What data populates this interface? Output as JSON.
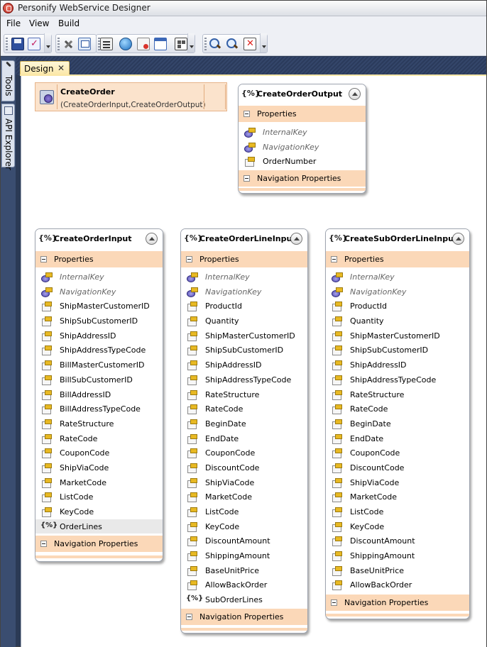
{
  "app": {
    "title": "Personify WebService Designer"
  },
  "menu": {
    "file": "File",
    "view": "View",
    "build": "Build"
  },
  "toolbar": {
    "icons": [
      "save-icon",
      "validate-icon",
      "tools-icon",
      "window-icon",
      "properties-icon",
      "web-service-icon",
      "delete-icon",
      "frame-icon",
      "layout-icon",
      "zoom-in-icon",
      "zoom-out-icon",
      "close-icon"
    ]
  },
  "side_tabs": {
    "tools": "Tools",
    "api_explorer": "API Explorer"
  },
  "doc_tab": {
    "label": "Design",
    "close": "✕"
  },
  "operation": {
    "name": "CreateOrder",
    "signature": "(CreateOrderInput,CreateOrderOutput)"
  },
  "entity_icon": "{%}",
  "sections": {
    "properties": "Properties",
    "navigation": "Navigation Properties"
  },
  "entities": [
    {
      "name": "CreateOrderOutput",
      "properties": [
        {
          "label": "InternalKey",
          "kind": "key",
          "italic": true
        },
        {
          "label": "NavigationKey",
          "kind": "key",
          "italic": true
        },
        {
          "label": "OrderNumber",
          "kind": "prop",
          "italic": false
        }
      ]
    },
    {
      "name": "CreateOrderInput",
      "properties": [
        {
          "label": "InternalKey",
          "kind": "key",
          "italic": true
        },
        {
          "label": "NavigationKey",
          "kind": "key",
          "italic": true
        },
        {
          "label": "ShipMasterCustomerID",
          "kind": "prop"
        },
        {
          "label": "ShipSubCustomerID",
          "kind": "prop"
        },
        {
          "label": "ShipAddressID",
          "kind": "prop"
        },
        {
          "label": "ShipAddressTypeCode",
          "kind": "prop"
        },
        {
          "label": "BillMasterCustomerID",
          "kind": "prop"
        },
        {
          "label": "BillSubCustomerID",
          "kind": "prop"
        },
        {
          "label": "BillAddressID",
          "kind": "prop"
        },
        {
          "label": "BillAddressTypeCode",
          "kind": "prop"
        },
        {
          "label": "RateStructure",
          "kind": "prop"
        },
        {
          "label": "RateCode",
          "kind": "prop"
        },
        {
          "label": "CouponCode",
          "kind": "prop"
        },
        {
          "label": "ShipViaCode",
          "kind": "prop"
        },
        {
          "label": "MarketCode",
          "kind": "prop"
        },
        {
          "label": "ListCode",
          "kind": "prop"
        },
        {
          "label": "KeyCode",
          "kind": "prop"
        },
        {
          "label": "OrderLines",
          "kind": "nav",
          "selected": true
        }
      ]
    },
    {
      "name": "CreateOrderLineInput",
      "properties": [
        {
          "label": "InternalKey",
          "kind": "key",
          "italic": true
        },
        {
          "label": "NavigationKey",
          "kind": "key",
          "italic": true
        },
        {
          "label": "ProductId",
          "kind": "prop"
        },
        {
          "label": "Quantity",
          "kind": "prop"
        },
        {
          "label": "ShipMasterCustomerID",
          "kind": "prop"
        },
        {
          "label": "ShipSubCustomerID",
          "kind": "prop"
        },
        {
          "label": "ShipAddressID",
          "kind": "prop"
        },
        {
          "label": "ShipAddressTypeCode",
          "kind": "prop"
        },
        {
          "label": "RateStructure",
          "kind": "prop"
        },
        {
          "label": "RateCode",
          "kind": "prop"
        },
        {
          "label": "BeginDate",
          "kind": "prop"
        },
        {
          "label": "EndDate",
          "kind": "prop"
        },
        {
          "label": "CouponCode",
          "kind": "prop"
        },
        {
          "label": "DiscountCode",
          "kind": "prop"
        },
        {
          "label": "ShipViaCode",
          "kind": "prop"
        },
        {
          "label": "MarketCode",
          "kind": "prop"
        },
        {
          "label": "ListCode",
          "kind": "prop"
        },
        {
          "label": "KeyCode",
          "kind": "prop"
        },
        {
          "label": "DiscountAmount",
          "kind": "prop"
        },
        {
          "label": "ShippingAmount",
          "kind": "prop"
        },
        {
          "label": "BaseUnitPrice",
          "kind": "prop"
        },
        {
          "label": "AllowBackOrder",
          "kind": "prop"
        },
        {
          "label": "SubOrderLines",
          "kind": "nav"
        }
      ]
    },
    {
      "name": "CreateSubOrderLineInput",
      "properties": [
        {
          "label": "InternalKey",
          "kind": "key",
          "italic": true
        },
        {
          "label": "NavigationKey",
          "kind": "key",
          "italic": true
        },
        {
          "label": "ProductId",
          "kind": "prop"
        },
        {
          "label": "Quantity",
          "kind": "prop"
        },
        {
          "label": "ShipMasterCustomerID",
          "kind": "prop"
        },
        {
          "label": "ShipSubCustomerID",
          "kind": "prop"
        },
        {
          "label": "ShipAddressID",
          "kind": "prop"
        },
        {
          "label": "ShipAddressTypeCode",
          "kind": "prop"
        },
        {
          "label": "RateStructure",
          "kind": "prop"
        },
        {
          "label": "RateCode",
          "kind": "prop"
        },
        {
          "label": "BeginDate",
          "kind": "prop"
        },
        {
          "label": "EndDate",
          "kind": "prop"
        },
        {
          "label": "CouponCode",
          "kind": "prop"
        },
        {
          "label": "DiscountCode",
          "kind": "prop"
        },
        {
          "label": "ShipViaCode",
          "kind": "prop"
        },
        {
          "label": "MarketCode",
          "kind": "prop"
        },
        {
          "label": "ListCode",
          "kind": "prop"
        },
        {
          "label": "KeyCode",
          "kind": "prop"
        },
        {
          "label": "DiscountAmount",
          "kind": "prop"
        },
        {
          "label": "ShippingAmount",
          "kind": "prop"
        },
        {
          "label": "BaseUnitPrice",
          "kind": "prop"
        },
        {
          "label": "AllowBackOrder",
          "kind": "prop"
        }
      ]
    }
  ]
}
